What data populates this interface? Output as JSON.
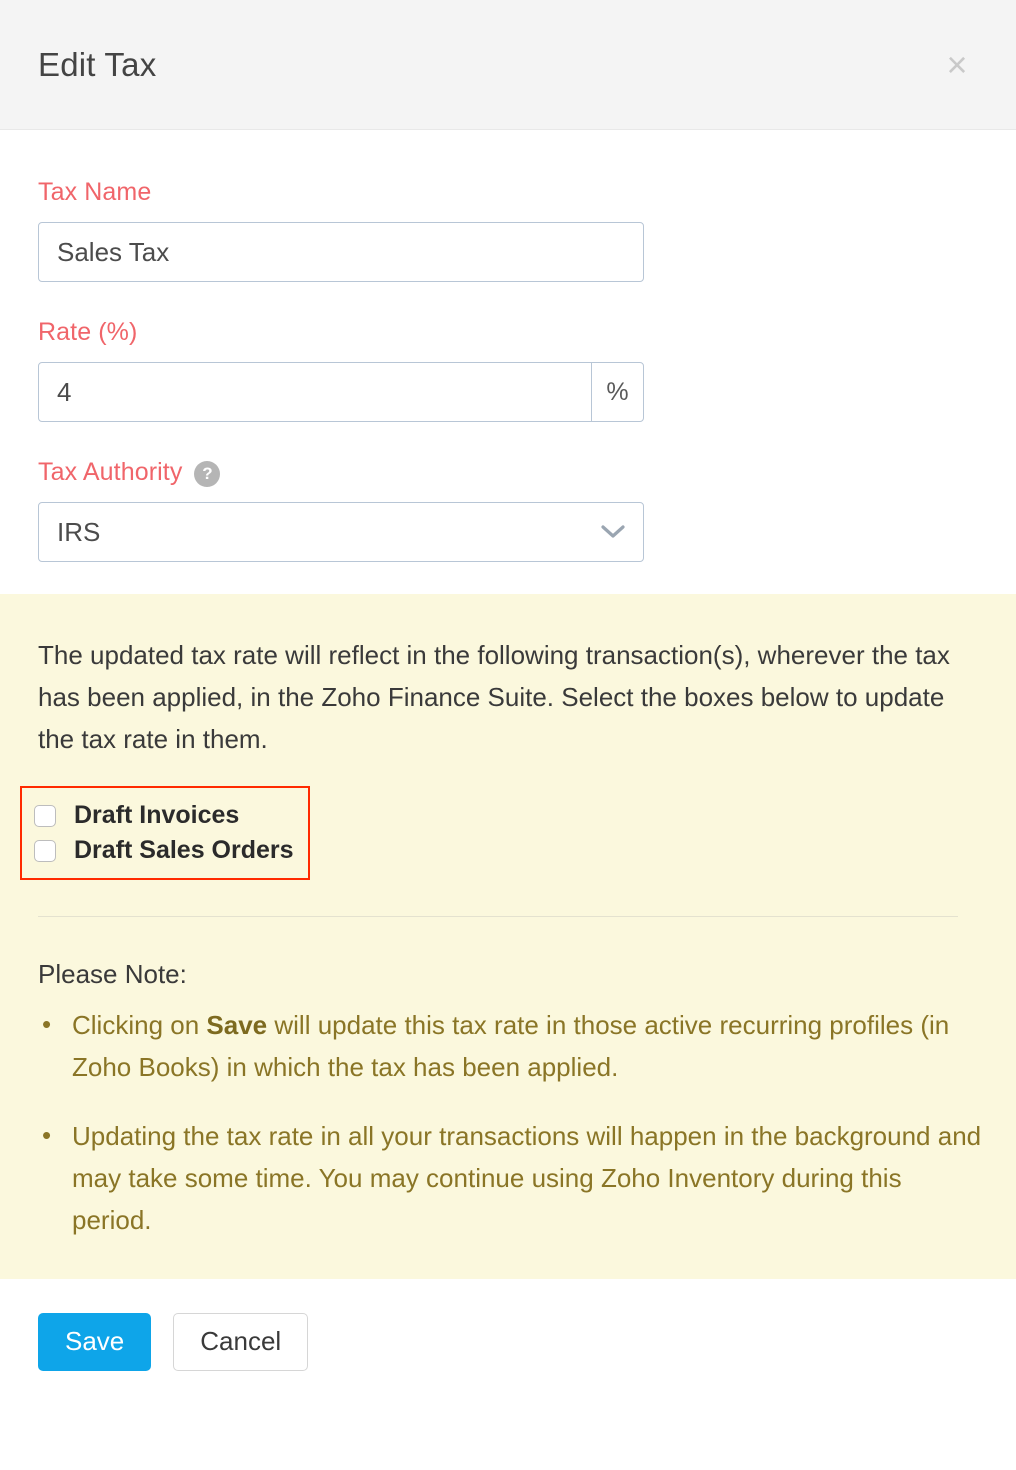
{
  "dialog": {
    "title": "Edit Tax",
    "close_icon": "close-icon"
  },
  "form": {
    "tax_name": {
      "label": "Tax Name",
      "value": "Sales Tax",
      "placeholder": ""
    },
    "rate": {
      "label": "Rate (%)",
      "value": "4",
      "placeholder": "",
      "addon": "%"
    },
    "tax_authority": {
      "label": "Tax Authority",
      "help_icon": "help-circle-icon",
      "help_glyph": "?",
      "value": "IRS",
      "options": [
        "IRS"
      ],
      "chevron_icon": "chevron-down-icon"
    }
  },
  "notice": {
    "message": "The updated tax rate will reflect in the following transaction(s), wherever the tax has been applied, in the Zoho Finance Suite. Select the boxes below to update the tax rate in them.",
    "checkboxes": [
      {
        "label": "Draft Invoices",
        "checked": false
      },
      {
        "label": "Draft Sales Orders",
        "checked": false
      }
    ],
    "highlight_color": "#ff2a00",
    "panel_color": "#fbf8dd",
    "please_note_heading": "Please Note:",
    "notes": [
      {
        "prefix": "Clicking on ",
        "bold": "Save",
        "suffix": " will update this tax rate in those active recurring profiles (in Zoho Books) in which the tax has been applied."
      },
      {
        "prefix": "Updating the tax rate in all your transactions will happen in the background and may take some time. You may continue using Zoho Inventory during this period.",
        "bold": "",
        "suffix": ""
      }
    ]
  },
  "footer": {
    "save_label": "Save",
    "cancel_label": "Cancel",
    "primary_color": "#0ea5e9"
  }
}
